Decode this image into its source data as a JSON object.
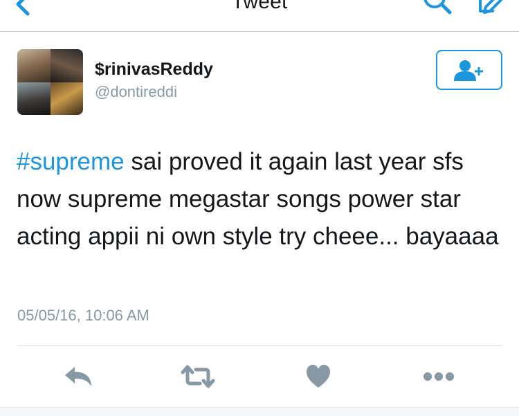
{
  "nav": {
    "title": "Tweet",
    "icons": [
      "back-chevron-icon",
      "search-icon",
      "compose-icon"
    ]
  },
  "tweet": {
    "author": {
      "display_name": "$rinivasReddy",
      "handle": "@dontireddi",
      "avatar": "avatar-photo-collage"
    },
    "hashtag": "#supreme",
    "body_text": " sai proved it again last year sfs now supreme megastar songs power star acting appii ni own style try cheee... bayaaaa",
    "timestamp": "05/05/16, 10:06 AM"
  },
  "actions": {
    "icons": [
      "reply-icon",
      "retweet-icon",
      "like-icon",
      "more-icon"
    ]
  },
  "colors": {
    "accent": "#1b95e0",
    "secondary_text": "#8899a6",
    "action_icon": "#8899a6",
    "primary_text": "#14171a"
  }
}
